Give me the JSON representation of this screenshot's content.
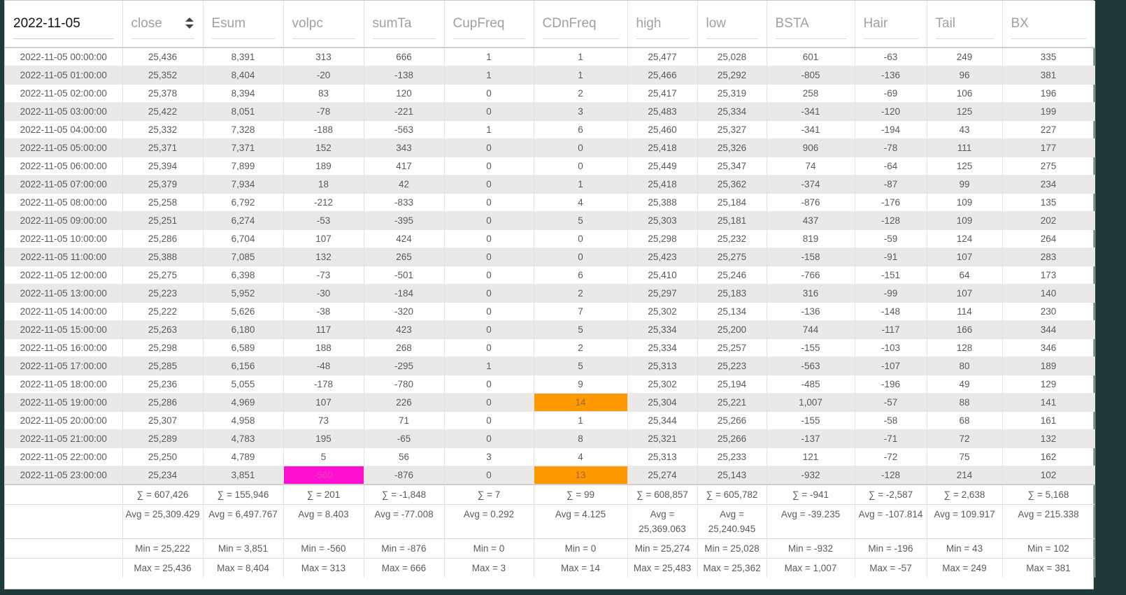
{
  "header": {
    "date": "2022-11-05",
    "columns": [
      "close",
      "Esum",
      "volpc",
      "sumTa",
      "CupFreq",
      "CDnFreq",
      "high",
      "low",
      "BSTA",
      "Hair",
      "Tail",
      "BX"
    ]
  },
  "rows": [
    [
      "2022-11-05 00:00:00",
      "25,436",
      "8,391",
      "313",
      "666",
      "1",
      "1",
      "25,477",
      "25,028",
      "601",
      "-63",
      "249",
      "335"
    ],
    [
      "2022-11-05 01:00:00",
      "25,352",
      "8,404",
      "-20",
      "-138",
      "1",
      "1",
      "25,466",
      "25,292",
      "-805",
      "-136",
      "96",
      "381"
    ],
    [
      "2022-11-05 02:00:00",
      "25,378",
      "8,394",
      "83",
      "120",
      "0",
      "2",
      "25,417",
      "25,319",
      "258",
      "-69",
      "106",
      "196"
    ],
    [
      "2022-11-05 03:00:00",
      "25,422",
      "8,051",
      "-78",
      "-221",
      "0",
      "3",
      "25,483",
      "25,334",
      "-341",
      "-120",
      "125",
      "199"
    ],
    [
      "2022-11-05 04:00:00",
      "25,332",
      "7,328",
      "-188",
      "-563",
      "1",
      "6",
      "25,460",
      "25,327",
      "-341",
      "-194",
      "43",
      "227"
    ],
    [
      "2022-11-05 05:00:00",
      "25,371",
      "7,371",
      "152",
      "343",
      "0",
      "0",
      "25,418",
      "25,326",
      "906",
      "-78",
      "111",
      "177"
    ],
    [
      "2022-11-05 06:00:00",
      "25,394",
      "7,899",
      "189",
      "417",
      "0",
      "0",
      "25,449",
      "25,347",
      "74",
      "-64",
      "125",
      "275"
    ],
    [
      "2022-11-05 07:00:00",
      "25,379",
      "7,934",
      "18",
      "42",
      "0",
      "1",
      "25,418",
      "25,362",
      "-374",
      "-87",
      "99",
      "234"
    ],
    [
      "2022-11-05 08:00:00",
      "25,258",
      "6,792",
      "-212",
      "-833",
      "0",
      "4",
      "25,388",
      "25,184",
      "-876",
      "-176",
      "109",
      "135"
    ],
    [
      "2022-11-05 09:00:00",
      "25,251",
      "6,274",
      "-53",
      "-395",
      "0",
      "5",
      "25,303",
      "25,181",
      "437",
      "-128",
      "109",
      "202"
    ],
    [
      "2022-11-05 10:00:00",
      "25,286",
      "6,704",
      "107",
      "424",
      "0",
      "0",
      "25,298",
      "25,232",
      "819",
      "-59",
      "124",
      "264"
    ],
    [
      "2022-11-05 11:00:00",
      "25,388",
      "7,085",
      "132",
      "265",
      "0",
      "0",
      "25,423",
      "25,275",
      "-158",
      "-91",
      "107",
      "283"
    ],
    [
      "2022-11-05 12:00:00",
      "25,275",
      "6,398",
      "-73",
      "-501",
      "0",
      "6",
      "25,410",
      "25,246",
      "-766",
      "-151",
      "64",
      "173"
    ],
    [
      "2022-11-05 13:00:00",
      "25,223",
      "5,952",
      "-30",
      "-184",
      "0",
      "2",
      "25,297",
      "25,183",
      "316",
      "-99",
      "107",
      "140"
    ],
    [
      "2022-11-05 14:00:00",
      "25,222",
      "5,626",
      "-38",
      "-320",
      "0",
      "7",
      "25,302",
      "25,134",
      "-136",
      "-148",
      "114",
      "230"
    ],
    [
      "2022-11-05 15:00:00",
      "25,263",
      "6,180",
      "117",
      "423",
      "0",
      "5",
      "25,334",
      "25,200",
      "744",
      "-117",
      "166",
      "344"
    ],
    [
      "2022-11-05 16:00:00",
      "25,298",
      "6,589",
      "188",
      "268",
      "0",
      "2",
      "25,334",
      "25,257",
      "-155",
      "-103",
      "128",
      "346"
    ],
    [
      "2022-11-05 17:00:00",
      "25,285",
      "6,156",
      "-48",
      "-295",
      "1",
      "5",
      "25,313",
      "25,223",
      "-563",
      "-107",
      "80",
      "189"
    ],
    [
      "2022-11-05 18:00:00",
      "25,236",
      "5,055",
      "-178",
      "-780",
      "0",
      "9",
      "25,302",
      "25,194",
      "-485",
      "-196",
      "49",
      "129"
    ],
    [
      "2022-11-05 19:00:00",
      "25,286",
      "4,969",
      "107",
      "226",
      "0",
      "14",
      "25,304",
      "25,221",
      "1,007",
      "-57",
      "88",
      "141"
    ],
    [
      "2022-11-05 20:00:00",
      "25,307",
      "4,958",
      "73",
      "71",
      "0",
      "1",
      "25,344",
      "25,266",
      "-155",
      "-58",
      "68",
      "161"
    ],
    [
      "2022-11-05 21:00:00",
      "25,289",
      "4,783",
      "195",
      "-65",
      "0",
      "8",
      "25,321",
      "25,266",
      "-137",
      "-71",
      "72",
      "132"
    ],
    [
      "2022-11-05 22:00:00",
      "25,250",
      "4,789",
      "5",
      "56",
      "3",
      "4",
      "25,313",
      "25,233",
      "121",
      "-72",
      "75",
      "162"
    ],
    [
      "2022-11-05 23:00:00",
      "25,234",
      "3,851",
      "-560",
      "-876",
      "0",
      "13",
      "25,274",
      "25,143",
      "-932",
      "-128",
      "214",
      "102"
    ]
  ],
  "highlights": [
    {
      "row": 19,
      "col": 6,
      "color": "#ff9900"
    },
    {
      "row": 23,
      "col": 6,
      "color": "#ff9900"
    },
    {
      "row": 23,
      "col": 3,
      "color": "#ff10d0"
    }
  ],
  "footer": {
    "sums": [
      "∑ = 607,426",
      "∑ = 155,946",
      "∑ = 201",
      "∑ = -1,848",
      "∑ = 7",
      "∑ = 99",
      "∑ = 608,857",
      "∑ = 605,782",
      "∑ = -941",
      "∑ = -2,587",
      "∑ = 2,638",
      "∑ = 5,168"
    ],
    "avgs": [
      "Avg = 25,309.429",
      "Avg = 6,497.767",
      "Avg = 8.403",
      "Avg = -77.008",
      "Avg = 0.292",
      "Avg = 4.125",
      "Avg = 25,369.063",
      "Avg = 25,240.945",
      "Avg = -39.235",
      "Avg = -107.814",
      "Avg = 109.917",
      "Avg = 215.338"
    ],
    "mins": [
      "Min = 25,222",
      "Min = 3,851",
      "Min = -560",
      "Min = -876",
      "Min = 0",
      "Min = 0",
      "Min = 25,274",
      "Min = 25,028",
      "Min = -932",
      "Min = -196",
      "Min = 43",
      "Min = 102"
    ],
    "maxs": [
      "Max = 25,436",
      "Max = 8,404",
      "Max = 313",
      "Max = 666",
      "Max = 3",
      "Max = 14",
      "Max = 25,483",
      "Max = 25,362",
      "Max = 1,007",
      "Max = -57",
      "Max = 249",
      "Max = 381"
    ]
  },
  "icons": {
    "sort": "sort-updown-icon"
  },
  "colors": {
    "orange": "#ff9900",
    "magenta": "#ff10d0",
    "alt_row": "#ebe8e8"
  }
}
